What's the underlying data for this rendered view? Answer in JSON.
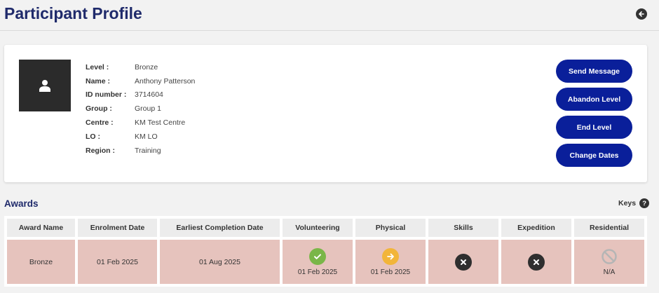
{
  "page": {
    "title": "Participant Profile"
  },
  "profile": {
    "fields": [
      {
        "label": "Level :",
        "value": "Bronze"
      },
      {
        "label": "Name :",
        "value": "Anthony Patterson"
      },
      {
        "label": "ID number :",
        "value": "3714604"
      },
      {
        "label": "Group :",
        "value": "Group 1"
      },
      {
        "label": "Centre :",
        "value": "KM Test Centre"
      },
      {
        "label": "LO :",
        "value": "KM LO"
      },
      {
        "label": "Region :",
        "value": "Training"
      }
    ],
    "actions": {
      "send_message": "Send Message",
      "abandon_level": "Abandon Level",
      "end_level": "End Level",
      "change_dates": "Change Dates"
    }
  },
  "awards": {
    "title": "Awards",
    "keys_label": "Keys",
    "keys_icon": "?",
    "headers": [
      "Award Name",
      "Enrolment Date",
      "Earliest Completion Date",
      "Volunteering",
      "Physical",
      "Skills",
      "Expedition",
      "Residential"
    ],
    "row": {
      "award_name": "Bronze",
      "enrolment_date": "01 Feb 2025",
      "earliest_completion_date": "01 Aug 2025",
      "volunteering": {
        "status": "check-icon",
        "date": "01 Feb 2025"
      },
      "physical": {
        "status": "arrow-right-icon",
        "date": "01 Feb 2025"
      },
      "skills": {
        "status": "cross-icon"
      },
      "expedition": {
        "status": "cross-icon"
      },
      "residential": {
        "status": "not-applicable-icon",
        "label": "N/A"
      }
    }
  },
  "colors": {
    "title": "#1f2a6b",
    "button": "#0a1f9a",
    "row_bg": "#e6c3bd",
    "header_bg": "#ececec",
    "check": "#7ab648",
    "arrow": "#f2b53a",
    "cross": "#2f2f2f",
    "na": "#b5b5b5"
  }
}
